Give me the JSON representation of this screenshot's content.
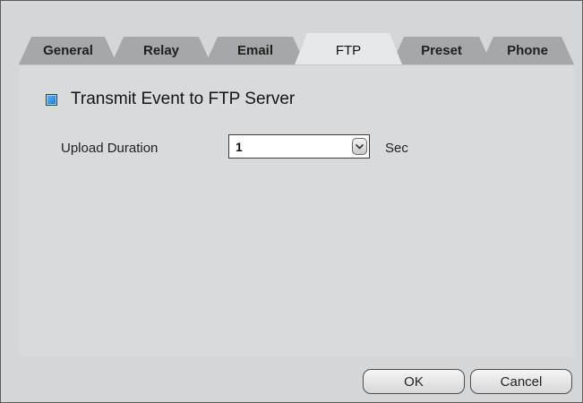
{
  "tabs": {
    "general": "General",
    "relay": "Relay",
    "email": "Email",
    "ftp": "FTP",
    "preset": "Preset",
    "phone": "Phone",
    "active": "FTP"
  },
  "ftp": {
    "transmit_label": "Transmit Event to FTP Server",
    "transmit_checked": true,
    "upload_duration_label": "Upload Duration",
    "upload_duration_value": "1",
    "unit_label": "Sec"
  },
  "buttons": {
    "ok": "OK",
    "cancel": "Cancel"
  },
  "icons": {
    "dropdown": "chevron-down-icon",
    "checkbox": "checkbox-checked-icon"
  },
  "colors": {
    "window_bg": "#d4d6d8",
    "tab_inactive": "#a5a7a9",
    "tab_active": "#e6e8ea",
    "checkbox_accent": "#1c72d6"
  }
}
